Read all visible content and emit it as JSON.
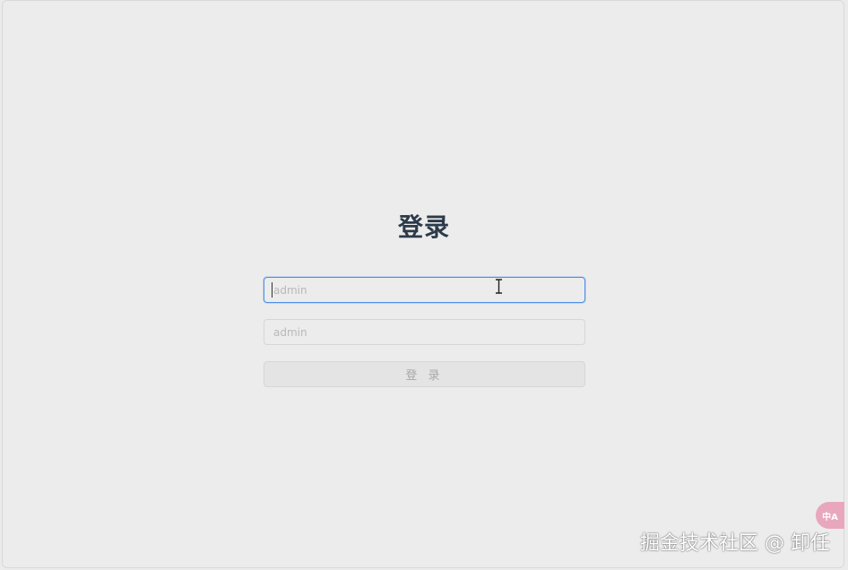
{
  "login": {
    "title": "登录",
    "username_placeholder": "admin",
    "password_placeholder": "admin",
    "submit_label": "登 录"
  },
  "overlay": {
    "translate_badge_text": "中A",
    "watermark_text": "掘金技术社区 @ 卸任"
  },
  "colors": {
    "focus_border": "#4d8fe8",
    "title_text": "#2c3a4a",
    "badge_bg": "#e8a7bd"
  }
}
